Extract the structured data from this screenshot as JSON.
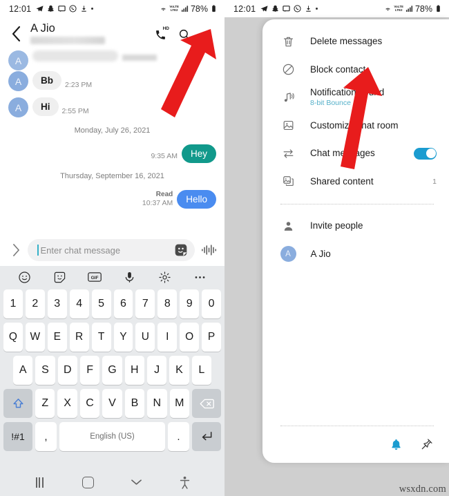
{
  "status_bar": {
    "time": "12:01",
    "left_icons": [
      "telegram-icon",
      "snapchat-icon",
      "message-icon",
      "whatsapp-icon",
      "download-icon",
      "dot-icon"
    ],
    "right_icons": [
      "wifi-icon",
      "volte-icon",
      "signal-icon"
    ],
    "volte_label_top": "VoLTE",
    "volte_label_bottom": "LTE2",
    "battery": "78%"
  },
  "left_screen": {
    "header": {
      "back_icon": "back-chevron-icon",
      "title": "A Jio",
      "call_icon": "hd-call-icon",
      "hd_badge": "HD",
      "search_icon": "search-icon",
      "more_icon": "kebab-menu-icon"
    },
    "messages": [
      {
        "type": "incoming",
        "avatar": "A",
        "text": "Bb",
        "time": "2:23 PM"
      },
      {
        "type": "incoming",
        "avatar": "A",
        "text": "Hi",
        "time": "2:55 PM"
      }
    ],
    "date_separator_1": "Monday, July 26, 2021",
    "outgoing_1": {
      "text": "Hey",
      "time": "9:35 AM",
      "color": "#11998b"
    },
    "date_separator_2": "Thursday, September 16, 2021",
    "outgoing_2": {
      "text": "Hello",
      "time": "10:37 AM",
      "status": "Read",
      "color": "#4a8cf0"
    },
    "input_bar": {
      "expand_icon": "chevron-right-icon",
      "placeholder": "Enter chat message",
      "value": "",
      "sticker_icon": "sticker-icon",
      "voice_icon": "voice-waveform-icon"
    },
    "keyboard": {
      "toolbar": [
        "emoji-icon",
        "sticker-icon",
        "gif-icon",
        "microphone-icon",
        "settings-gear-icon",
        "more-dots-icon"
      ],
      "gif_label": "GIF",
      "row1": [
        "1",
        "2",
        "3",
        "4",
        "5",
        "6",
        "7",
        "8",
        "9",
        "0"
      ],
      "row2": [
        "Q",
        "W",
        "E",
        "R",
        "T",
        "Y",
        "U",
        "I",
        "O",
        "P"
      ],
      "row3": [
        "A",
        "S",
        "D",
        "F",
        "G",
        "H",
        "J",
        "K",
        "L"
      ],
      "row4": [
        "Z",
        "X",
        "C",
        "V",
        "B",
        "N",
        "M"
      ],
      "shift_icon": "shift-arrow-icon",
      "backspace_icon": "backspace-icon",
      "symbols_label": "!#1",
      "comma_label": ",",
      "space_label": "English (US)",
      "period_label": ".",
      "enter_icon": "enter-return-icon"
    },
    "nav_bar": {
      "recents_icon": "recents-icon",
      "home_icon": "home-icon",
      "hide_keyboard_icon": "chevron-down-icon",
      "accessibility_icon": "accessibility-icon"
    }
  },
  "right_screen": {
    "header": {
      "back_icon": "back-chevron-icon"
    },
    "menu": [
      {
        "icon": "trash-icon",
        "label": "Delete messages"
      },
      {
        "icon": "block-icon",
        "label": "Block contact"
      },
      {
        "icon": "notification-sound-icon",
        "label": "Notification sound",
        "sub": "8-bit Bounce"
      },
      {
        "icon": "image-frame-icon",
        "label": "Customize chat room"
      },
      {
        "icon": "swap-arrows-icon",
        "label": "Chat messages",
        "toggle": true,
        "toggle_on": true
      },
      {
        "icon": "shared-content-icon",
        "label": "Shared content",
        "count": "1"
      }
    ],
    "people": [
      {
        "icon": "person-icon",
        "label": "Invite people"
      },
      {
        "avatar": "A",
        "label": "A Jio"
      }
    ],
    "footer_icons": [
      "notification-bell-icon",
      "pin-icon"
    ],
    "nav_bar": {
      "recents_icon": "recents-icon",
      "home_icon": "home-icon",
      "back_icon": "back-chevron-icon",
      "accessibility_icon": "accessibility-icon"
    }
  },
  "annotations": {
    "arrow_color": "#e81c1c",
    "arrow_1_target": "kebab-menu-icon",
    "arrow_2_target": "Block contact"
  },
  "watermark": "wsxdn.com"
}
